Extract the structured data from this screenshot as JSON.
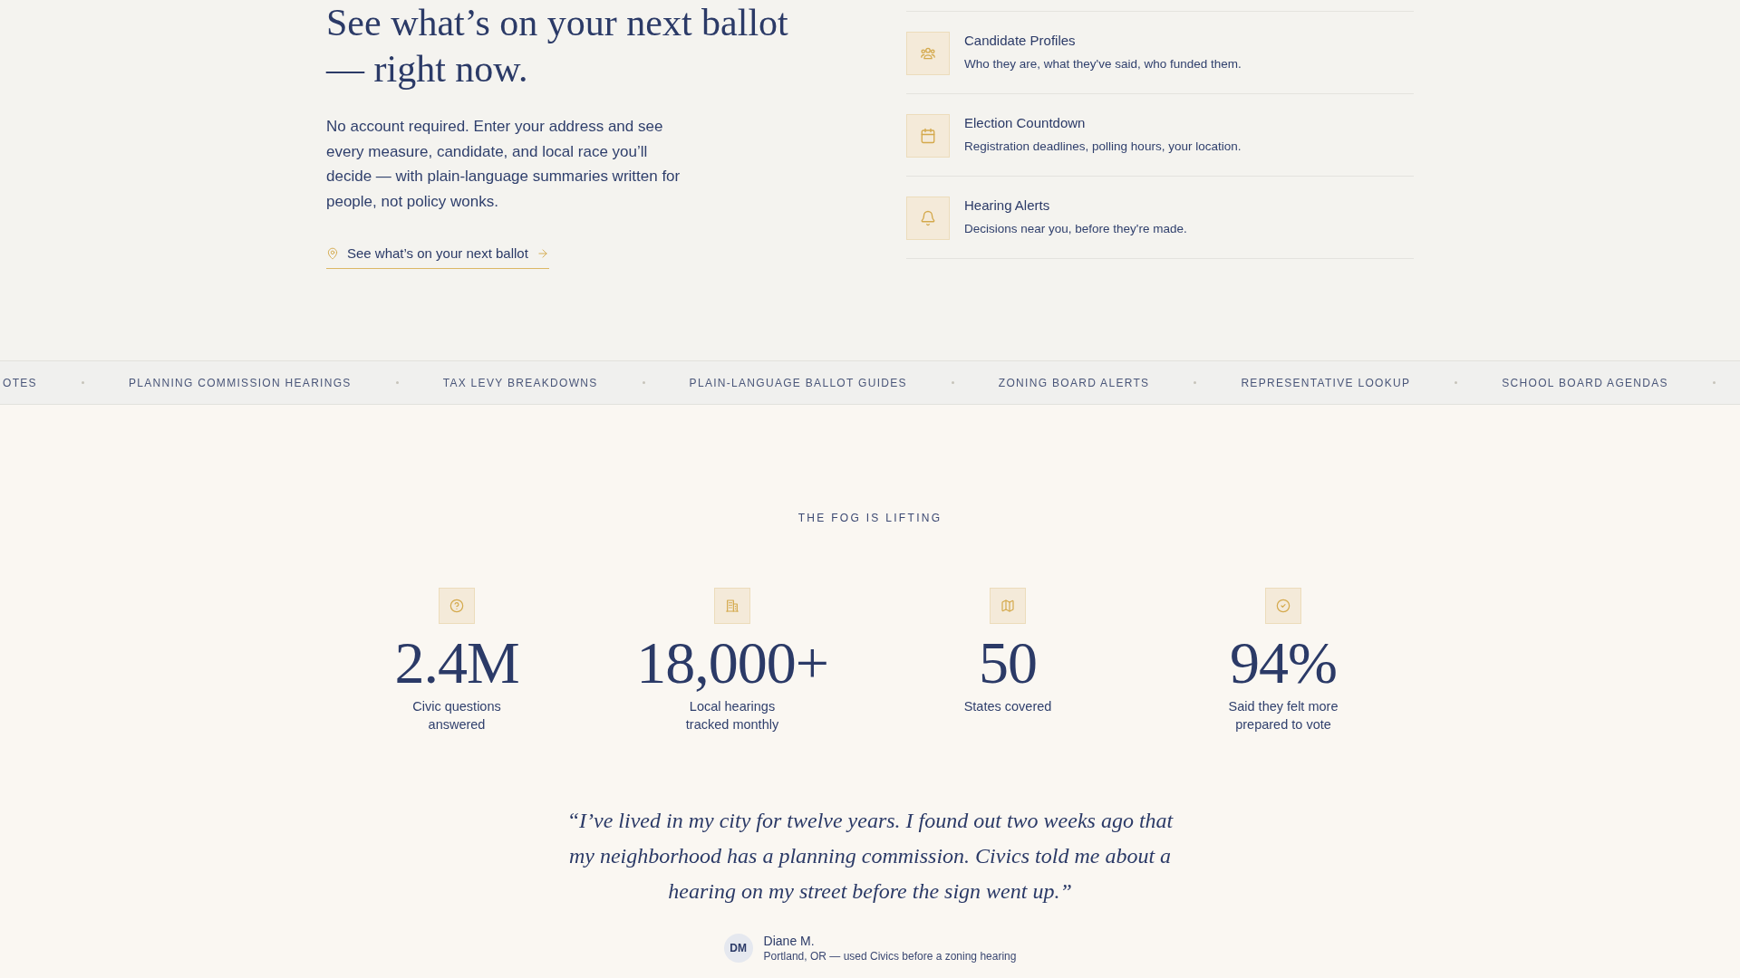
{
  "hero": {
    "headline": "See what’s on your next ballot — right now.",
    "intro": "No account required. Enter your address and see every measure, candidate, and local race you’ll decide — with plain-language summaries written for people, not policy wonks.",
    "cta": "See what’s on your next ballot"
  },
  "features": [
    {
      "title": "Candidate Profiles",
      "description": "Who they are, what they've said, who funded them."
    },
    {
      "title": "Election Countdown",
      "description": "Registration deadlines, polling hours, your location."
    },
    {
      "title": "Hearing Alerts",
      "description": "Decisions near you, before they're made."
    }
  ],
  "ticker": [
    "OTES",
    "PLANNING COMMISSION HEARINGS",
    "TAX LEVY BREAKDOWNS",
    "PLAIN-LANGUAGE BALLOT GUIDES",
    "ZONING BOARD ALERTS",
    "REPRESENTATIVE LOOKUP",
    "SCHOOL BOARD AGENDAS"
  ],
  "stats": {
    "eyebrow": "THE FOG IS LIFTING",
    "items": [
      {
        "value": "2.4M",
        "label": "Civic questions answered"
      },
      {
        "value": "18,000+",
        "label": "Local hearings tracked monthly"
      },
      {
        "value": "50",
        "label": "States covered"
      },
      {
        "value": "94%",
        "label": "Said they felt more prepared to vote"
      }
    ]
  },
  "testimonial": {
    "quote": "“I’ve lived in my city for twelve years. I found out two weeks ago that my neighborhood has a planning commission. Civics told me about a hearing on my street before the sign went up.”",
    "initials": "DM",
    "name": "Diane M.",
    "detail": "Portland, OR — used Civics before a zoning hearing"
  }
}
